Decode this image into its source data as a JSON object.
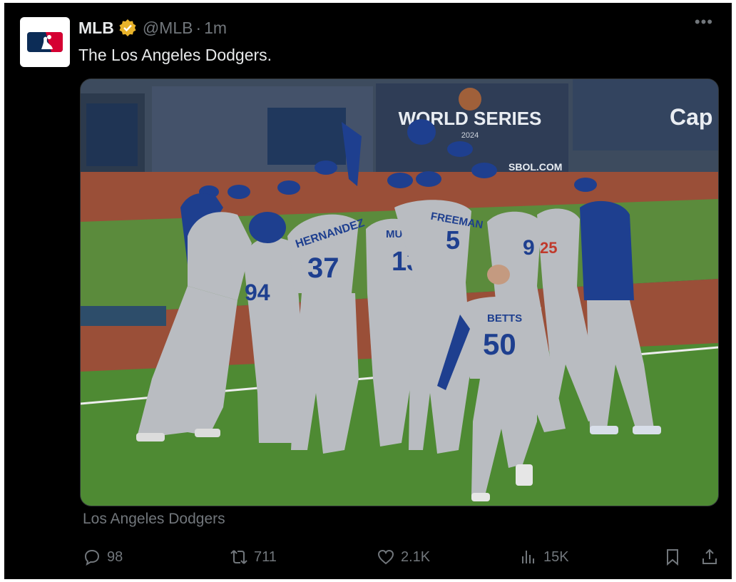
{
  "author": {
    "name": "MLB",
    "handle": "@MLB",
    "separator": "·",
    "time": "1m",
    "verified_badge_color": "#e8b32a"
  },
  "more_menu": "•••",
  "tweet_text": "The Los Angeles Dodgers.",
  "media": {
    "banner_text": "WORLD SERIES",
    "banner_year": "2024",
    "sponsor_text": "Cap",
    "ad_text": "SBOL.COM",
    "jerseys": [
      {
        "name": "HERNANDEZ",
        "number": "37"
      },
      {
        "name": "FREEMAN",
        "number": "5"
      },
      {
        "name": "MUNCY",
        "number": "13"
      },
      {
        "name": "BETTS",
        "number": "50"
      },
      {
        "name": "",
        "number": "9"
      },
      {
        "name": "",
        "number": "25"
      },
      {
        "name": "",
        "number": "94"
      }
    ]
  },
  "source_label": "Los Angeles Dodgers",
  "actions": {
    "replies": "98",
    "reposts": "711",
    "likes": "2.1K",
    "views": "15K"
  },
  "colors": {
    "background": "#000000",
    "primary_text": "#e7e9ea",
    "secondary_text": "#71767b",
    "jersey_gray": "#b9bcc1",
    "dodger_blue": "#1e3f8f"
  },
  "icons": {
    "reply": "reply-icon",
    "repost": "repost-icon",
    "like": "heart-icon",
    "views": "views-icon",
    "bookmark": "bookmark-icon",
    "share": "share-icon"
  }
}
